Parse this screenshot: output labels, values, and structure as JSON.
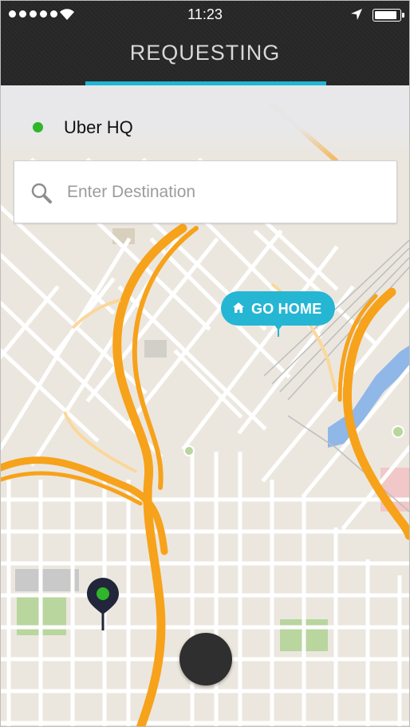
{
  "status_bar": {
    "time": "11:23",
    "signal_bars": 5,
    "battery_level": 0.9
  },
  "header": {
    "title": "REQUESTING",
    "progress": 0.59
  },
  "pickup": {
    "label": "Uber HQ"
  },
  "search": {
    "placeholder": "Enter Destination",
    "value": ""
  },
  "map": {
    "shortcut": {
      "label": "GO HOME",
      "icon": "home-icon"
    },
    "pin_icon": "location-pin-icon"
  },
  "colors": {
    "accent": "#1fb6d3",
    "pickup_dot": "#2fb62b",
    "highway": "#f7a21b",
    "header_bg": "#262626"
  }
}
